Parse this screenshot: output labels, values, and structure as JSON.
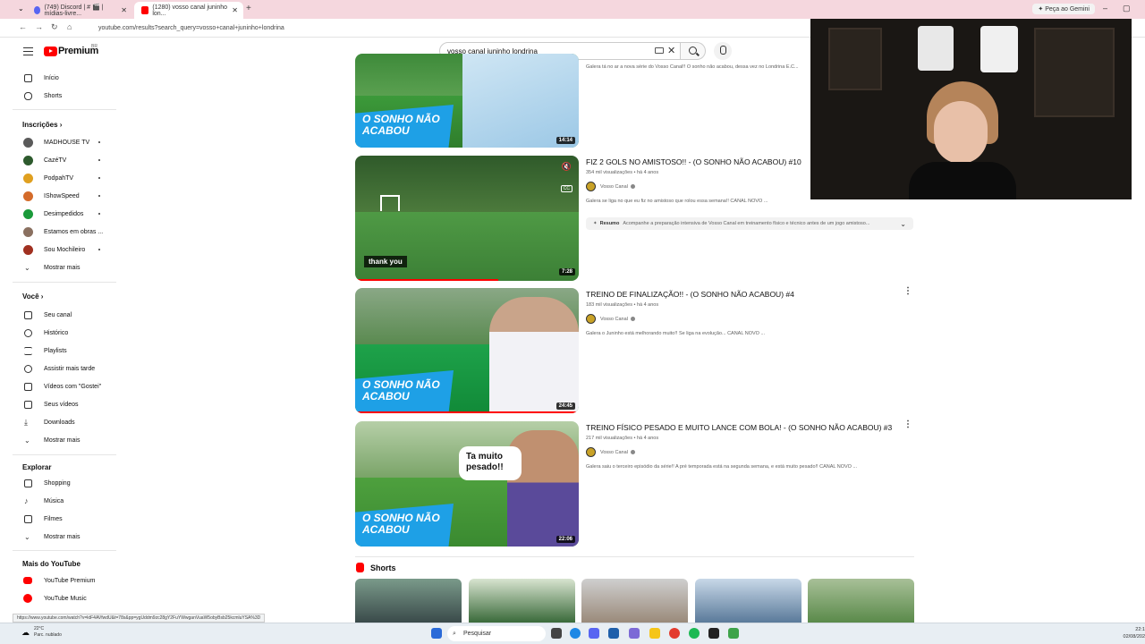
{
  "browser": {
    "tabs": [
      {
        "title": "(749) Discord | # 🎬 | mídias-livre...",
        "active": false
      },
      {
        "title": "(1280) vosso canal juninho lon...",
        "active": true
      }
    ],
    "url": "youtube.com/results?search_query=vosso+canal+juninho+londrina",
    "gemini_label": "Peça ao Gemini",
    "status_url": "https://www.youtube.com/watch?v=ktF4AVfwdU&t=78s&pp=ygUddm9zc28gY2FuYWwganVuaW5obyBsb25kcmluYSA%3D"
  },
  "youtube": {
    "logo_text": "Premium",
    "logo_region": "BR",
    "search_value": "vosso canal juninho londrina"
  },
  "sidebar": {
    "main": [
      {
        "label": "Início",
        "icon": "home-icon"
      },
      {
        "label": "Shorts",
        "icon": "shorts-icon"
      }
    ],
    "subs_header": "Inscrições",
    "subs": [
      {
        "label": "MADHOUSE TV",
        "color": "#5a5a5a"
      },
      {
        "label": "CazéTV",
        "color": "#2d5a2d"
      },
      {
        "label": "PodpahTV",
        "color": "#e0a020"
      },
      {
        "label": "IShowSpeed",
        "color": "#d46b2a"
      },
      {
        "label": "Desimpedidos",
        "color": "#1a9a3a"
      },
      {
        "label": "Estamos em obras ...",
        "color": "#8a7060"
      },
      {
        "label": "Sou Mochileiro",
        "color": "#a03020"
      }
    ],
    "show_more": "Mostrar mais",
    "you_header": "Você",
    "you": [
      {
        "label": "Seu canal",
        "icon": "channel-icon"
      },
      {
        "label": "Histórico",
        "icon": "history-icon"
      },
      {
        "label": "Playlists",
        "icon": "playlists-icon"
      },
      {
        "label": "Assistir mais tarde",
        "icon": "watch-later-icon"
      },
      {
        "label": "Vídeos com \"Gostei\"",
        "icon": "like-icon"
      },
      {
        "label": "Seus vídeos",
        "icon": "your-videos-icon"
      },
      {
        "label": "Downloads",
        "icon": "download-icon"
      }
    ],
    "explore_header": "Explorar",
    "explore": [
      {
        "label": "Shopping",
        "icon": "shopping-icon"
      },
      {
        "label": "Música",
        "icon": "music-icon"
      },
      {
        "label": "Filmes",
        "icon": "movies-icon"
      }
    ],
    "more_header": "Mais do YouTube",
    "more": [
      {
        "label": "YouTube Premium",
        "icon": "yt-premium-icon"
      },
      {
        "label": "YouTube Music",
        "icon": "yt-music-icon"
      }
    ]
  },
  "results": [
    {
      "title": "",
      "views": "",
      "channel": "",
      "desc": "Galera tá no ar a nova série do Vosso Canal!! O sonho não acabou, dessa vez no Londrina E.C...",
      "duration": "14:14",
      "brand_text": "O SONHO NÃO ACABOU"
    },
    {
      "title": "FIZ 2 GOLS NO AMISTOSO!! - (O SONHO NÃO ACABOU) #10",
      "views": "354 mil visualizações • há 4 anos",
      "channel": "Vosso Canal",
      "desc": "Galera se liga no que eu fiz no amistoso que rolou essa semana!! CANAL NOVO ...",
      "duration": "7:28",
      "caption": "thank you",
      "summary_label": "Resumo",
      "summary": "Acompanhe a preparação intensiva de Vosso Canal em treinamento físico e técnico antes de um jogo amistoso...",
      "progress": 0.64
    },
    {
      "title": "TREINO DE FINALIZAÇÃO!! - (O SONHO NÃO ACABOU) #4",
      "views": "183 mil visualizações • há 4 anos",
      "channel": "Vosso Canal",
      "desc": "Galera o Juninho está melhorando muito!! Se liga na evolução... CANAL NOVO ...",
      "duration": "24:45",
      "brand_text": "O SONHO NÃO ACABOU"
    },
    {
      "title": "TREINO FÍSICO PESADO E MUITO LANCE COM BOLA! - (O SONHO NÃO ACABOU) #3",
      "views": "217 mil visualizações • há 4 anos",
      "channel": "Vosso Canal",
      "desc": "Galera saiu o terceiro episódio da série!! A pré temporada está na segunda semana, e está muito pesado!! CANAL NOVO ...",
      "duration": "22:06",
      "brand_text": "O SONHO NÃO ACABOU",
      "bubble": "Ta muito pesado!!"
    }
  ],
  "shorts_header": "Shorts",
  "taskbar": {
    "search": "Pesquisar",
    "temp": "22°C",
    "weather": "Parc. nublado",
    "time": "22:1",
    "date": "02/08/202"
  }
}
